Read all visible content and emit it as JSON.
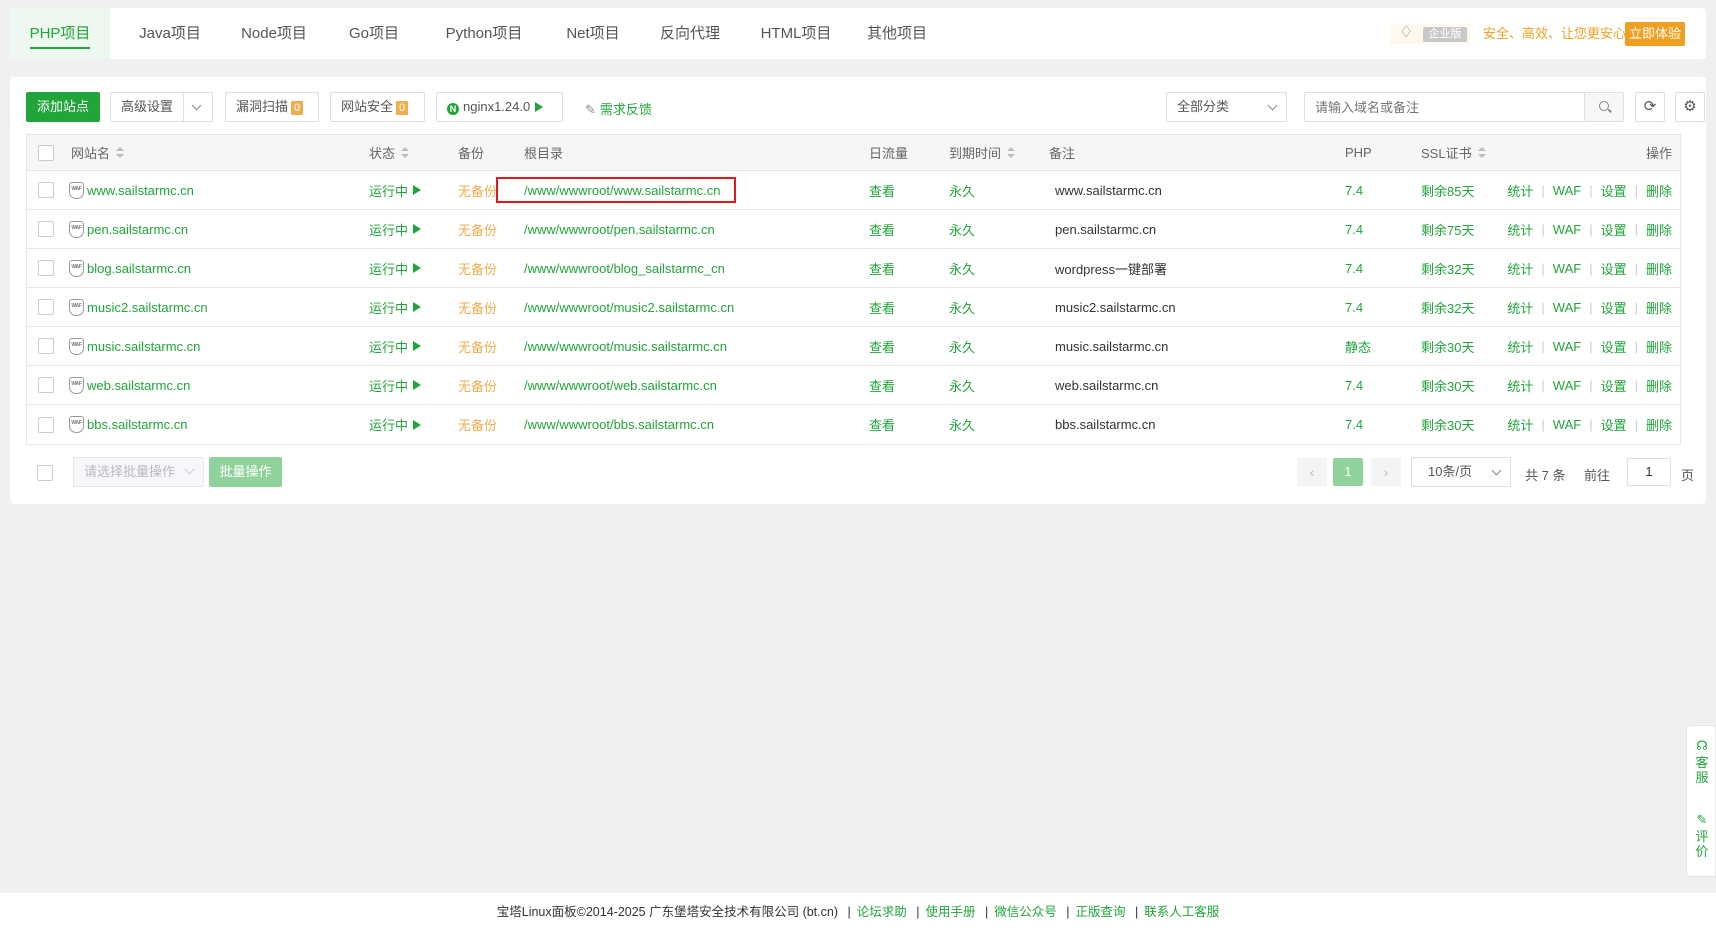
{
  "tabs": [
    "PHP项目",
    "Java项目",
    "Node项目",
    "Go项目",
    "Python项目",
    "Net项目",
    "反向代理",
    "HTML项目",
    "其他项目"
  ],
  "enterprise": {
    "tag": "企业版",
    "slogan": "安全、高效、让您更安心",
    "button": "立即体验"
  },
  "toolbar": {
    "add_site": "添加站点",
    "advanced": "高级设置",
    "vuln_scan": "漏洞扫描",
    "vuln_count": "0",
    "site_security": "网站安全",
    "security_count": "0",
    "nginx": "nginx1.24.0",
    "feedback": "需求反馈",
    "category": "全部分类",
    "search_placeholder": "请输入域名或备注"
  },
  "table": {
    "headers": {
      "name": "网站名",
      "status": "状态",
      "backup": "备份",
      "root": "根目录",
      "traffic": "日流量",
      "expire": "到期时间",
      "remark": "备注",
      "php": "PHP",
      "ssl": "SSL证书",
      "ops": "操作"
    },
    "waf_icon_text": "WAF",
    "actions": [
      "统计",
      "WAF",
      "设置",
      "删除"
    ],
    "rows": [
      {
        "name": "www.sailstarmc.cn",
        "status": "运行中",
        "backup": "无备份",
        "root": "/www/wwwroot/www.sailstarmc.cn",
        "traffic": "查看",
        "expire": "永久",
        "remark": "www.sailstarmc.cn",
        "php": "7.4",
        "ssl": "剩余85天"
      },
      {
        "name": "pen.sailstarmc.cn",
        "status": "运行中",
        "backup": "无备份",
        "root": "/www/wwwroot/pen.sailstarmc.cn",
        "traffic": "查看",
        "expire": "永久",
        "remark": "pen.sailstarmc.cn",
        "php": "7.4",
        "ssl": "剩余75天"
      },
      {
        "name": "blog.sailstarmc.cn",
        "status": "运行中",
        "backup": "无备份",
        "root": "/www/wwwroot/blog_sailstarmc_cn",
        "traffic": "查看",
        "expire": "永久",
        "remark": "wordpress一键部署",
        "php": "7.4",
        "ssl": "剩余32天"
      },
      {
        "name": "music2.sailstarmc.cn",
        "status": "运行中",
        "backup": "无备份",
        "root": "/www/wwwroot/music2.sailstarmc.cn",
        "traffic": "查看",
        "expire": "永久",
        "remark": "music2.sailstarmc.cn",
        "php": "7.4",
        "ssl": "剩余32天"
      },
      {
        "name": "music.sailstarmc.cn",
        "status": "运行中",
        "backup": "无备份",
        "root": "/www/wwwroot/music.sailstarmc.cn",
        "traffic": "查看",
        "expire": "永久",
        "remark": "music.sailstarmc.cn",
        "php": "静态",
        "ssl": "剩余30天"
      },
      {
        "name": "web.sailstarmc.cn",
        "status": "运行中",
        "backup": "无备份",
        "root": "/www/wwwroot/web.sailstarmc.cn",
        "traffic": "查看",
        "expire": "永久",
        "remark": "web.sailstarmc.cn",
        "php": "7.4",
        "ssl": "剩余30天"
      },
      {
        "name": "bbs.sailstarmc.cn",
        "status": "运行中",
        "backup": "无备份",
        "root": "/www/wwwroot/bbs.sailstarmc.cn",
        "traffic": "查看",
        "expire": "永久",
        "remark": "bbs.sailstarmc.cn",
        "php": "7.4",
        "ssl": "剩余30天"
      }
    ]
  },
  "batch": {
    "placeholder": "请选择批量操作",
    "button": "批量操作"
  },
  "pagination": {
    "current": "1",
    "per_page": "10条/页",
    "total": "共 7 条",
    "goto": "前往",
    "page_input": "1",
    "page_suffix": "页"
  },
  "footer": {
    "copyright": "宝塔Linux面板©2014-2025 广东堡塔安全技术有限公司 (bt.cn)",
    "links": [
      "论坛求助",
      "使用手册",
      "微信公众号",
      "正版查询",
      "联系人工客服"
    ]
  },
  "side": {
    "service": "客服",
    "review": "评价"
  },
  "colors": {
    "accent": "#20a53a",
    "warning": "#f0ad4e",
    "highlight": "#e0191f"
  }
}
